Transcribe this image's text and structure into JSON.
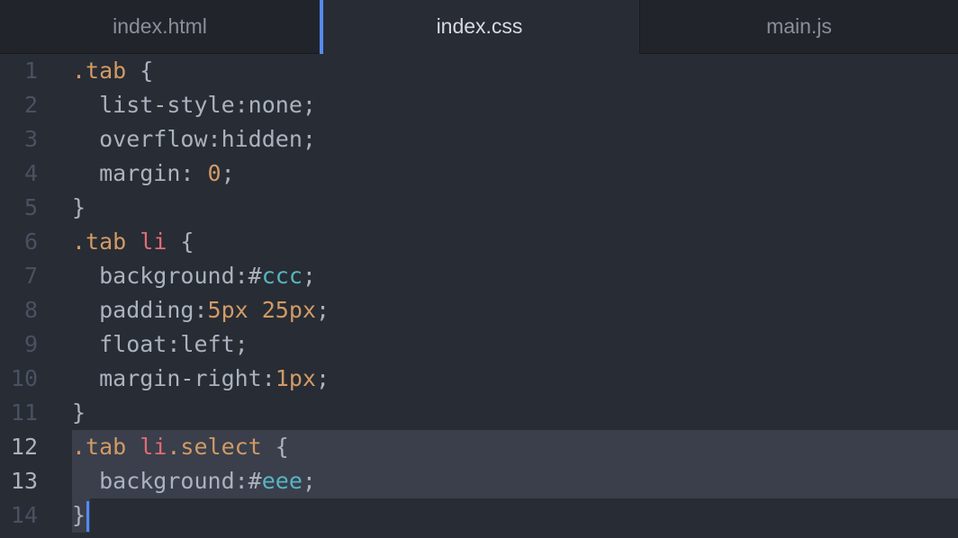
{
  "tabs": [
    {
      "label": "index.html",
      "active": false
    },
    {
      "label": "index.css",
      "active": true
    },
    {
      "label": "main.js",
      "active": false
    }
  ],
  "lines": [
    {
      "num": "1",
      "tokens": [
        {
          "t": ".tab",
          "c": "sel"
        },
        {
          "t": " {",
          "c": "txt"
        }
      ]
    },
    {
      "num": "2",
      "tokens": [
        {
          "t": "  list-style:none;",
          "c": "txt"
        }
      ]
    },
    {
      "num": "3",
      "tokens": [
        {
          "t": "  overflow:hidden;",
          "c": "txt"
        }
      ]
    },
    {
      "num": "4",
      "tokens": [
        {
          "t": "  margin: ",
          "c": "txt"
        },
        {
          "t": "0",
          "c": "num"
        },
        {
          "t": ";",
          "c": "txt"
        }
      ]
    },
    {
      "num": "5",
      "tokens": [
        {
          "t": "}",
          "c": "txt"
        }
      ]
    },
    {
      "num": "6",
      "tokens": [
        {
          "t": ".tab ",
          "c": "sel"
        },
        {
          "t": "li",
          "c": "tag"
        },
        {
          "t": " {",
          "c": "txt"
        }
      ]
    },
    {
      "num": "7",
      "tokens": [
        {
          "t": "  background:#",
          "c": "txt"
        },
        {
          "t": "ccc",
          "c": "hex"
        },
        {
          "t": ";",
          "c": "txt"
        }
      ]
    },
    {
      "num": "8",
      "tokens": [
        {
          "t": "  padding:",
          "c": "txt"
        },
        {
          "t": "5px 25px",
          "c": "num"
        },
        {
          "t": ";",
          "c": "txt"
        }
      ]
    },
    {
      "num": "9",
      "tokens": [
        {
          "t": "  float:left;",
          "c": "txt"
        }
      ]
    },
    {
      "num": "10",
      "tokens": [
        {
          "t": "  margin-right:",
          "c": "txt"
        },
        {
          "t": "1px",
          "c": "num"
        },
        {
          "t": ";",
          "c": "txt"
        }
      ]
    },
    {
      "num": "11",
      "tokens": [
        {
          "t": "}",
          "c": "txt"
        }
      ]
    },
    {
      "num": "12",
      "tokens": [
        {
          "t": ".tab ",
          "c": "sel"
        },
        {
          "t": "li",
          "c": "tag"
        },
        {
          "t": ".select",
          "c": "sel"
        },
        {
          "t": " {",
          "c": "txt"
        }
      ],
      "highlight": true
    },
    {
      "num": "13",
      "tokens": [
        {
          "t": "  background:#",
          "c": "txt"
        },
        {
          "t": "eee",
          "c": "hex"
        },
        {
          "t": ";",
          "c": "txt"
        }
      ],
      "highlight": true
    },
    {
      "num": "14",
      "tokens": [
        {
          "t": "}",
          "c": "txt"
        }
      ],
      "cursor": true
    }
  ],
  "colors": {
    "background": "#282c34",
    "tabbar": "#21252b",
    "accent": "#568af2",
    "selector": "#d19a66",
    "tag": "#e06c75",
    "hex": "#56b6c2",
    "text": "#abb2bf",
    "gutter": "#495162",
    "highlight": "#3a3f4b"
  }
}
